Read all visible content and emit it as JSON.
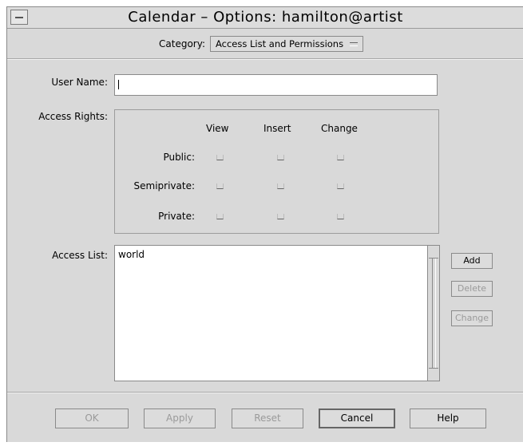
{
  "window": {
    "title": "Calendar – Options: hamilton@artist"
  },
  "category": {
    "label": "Category:",
    "selected": "Access List and Permissions"
  },
  "user_name": {
    "label": "User Name:",
    "value": ""
  },
  "access_rights": {
    "label": "Access Rights:",
    "columns": [
      "View",
      "Insert",
      "Change"
    ],
    "rows": [
      "Public:",
      "Semiprivate:",
      "Private:"
    ]
  },
  "access_list": {
    "label": "Access List:",
    "items": [
      "world"
    ]
  },
  "side_buttons": {
    "add": "Add",
    "delete": "Delete",
    "change": "Change"
  },
  "bottom_buttons": {
    "ok": "OK",
    "apply": "Apply",
    "reset": "Reset",
    "cancel": "Cancel",
    "help": "Help"
  },
  "colors": {
    "window_bg": "#d9d9d9",
    "field_bg": "#ffffff",
    "disabled_text": "#9a9a9a"
  }
}
